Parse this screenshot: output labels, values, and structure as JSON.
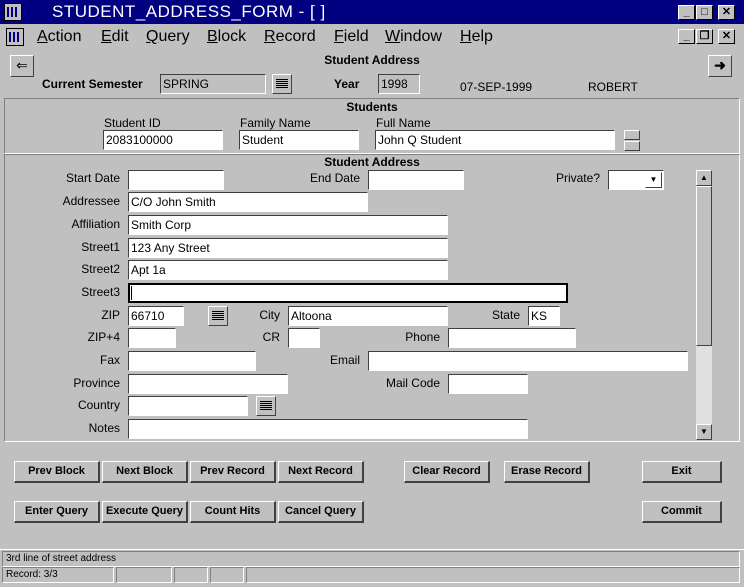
{
  "window": {
    "title": "STUDENT_ADDRESS_FORM - [ ]",
    "app_icon": "oracle-forms-icon"
  },
  "menu": {
    "items": [
      "Action",
      "Edit",
      "Query",
      "Block",
      "Record",
      "Field",
      "Window",
      "Help"
    ],
    "access_keys": [
      "A",
      "E",
      "Q",
      "B",
      "R",
      "F",
      "W",
      "H"
    ]
  },
  "form": {
    "title": "Student Address",
    "current_semester_label": "Current Semester",
    "current_semester_value": "SPRING",
    "year_label": "Year",
    "year_value": "1998",
    "date": "07-SEP-1999",
    "user": "ROBERT"
  },
  "students": {
    "title": "Students",
    "student_id_label": "Student ID",
    "student_id_value": "2083100000",
    "family_name_label": "Family Name",
    "family_name_value": "Student",
    "full_name_label": "Full Name",
    "full_name_value": "John Q Student"
  },
  "address": {
    "title": "Student Address",
    "start_date_label": "Start Date",
    "start_date_value": "",
    "end_date_label": "End Date",
    "end_date_value": "",
    "private_label": "Private?",
    "private_value": "",
    "addressee_label": "Addressee",
    "addressee_value": "C/O John Smith",
    "affiliation_label": "Affiliation",
    "affiliation_value": "Smith Corp",
    "street1_label": "Street1",
    "street1_value": "123 Any Street",
    "street2_label": "Street2",
    "street2_value": "Apt 1a",
    "street3_label": "Street3",
    "street3_value": "",
    "zip_label": "ZIP",
    "zip_value": "66710",
    "city_label": "City",
    "city_value": "Altoona",
    "state_label": "State",
    "state_value": "KS",
    "zip4_label": "ZIP+4",
    "zip4_value": "",
    "cr_label": "CR",
    "cr_value": "",
    "phone_label": "Phone",
    "phone_value": "",
    "fax_label": "Fax",
    "fax_value": "",
    "email_label": "Email",
    "email_value": "",
    "province_label": "Province",
    "province_value": "",
    "mail_code_label": "Mail Code",
    "mail_code_value": "",
    "country_label": "Country",
    "country_value": "",
    "notes_label": "Notes",
    "notes_value": ""
  },
  "buttons": {
    "prev_block": "Prev Block",
    "next_block": "Next Block",
    "prev_record": "Prev Record",
    "next_record": "Next Record",
    "clear_record": "Clear Record",
    "erase_record": "Erase Record",
    "exit": "Exit",
    "enter_query": "Enter Query",
    "execute_query": "Execute Query",
    "count_hits": "Count Hits",
    "cancel_query": "Cancel Query",
    "commit": "Commit"
  },
  "status": {
    "hint": "3rd line of street address",
    "record": "Record: 3/3"
  }
}
